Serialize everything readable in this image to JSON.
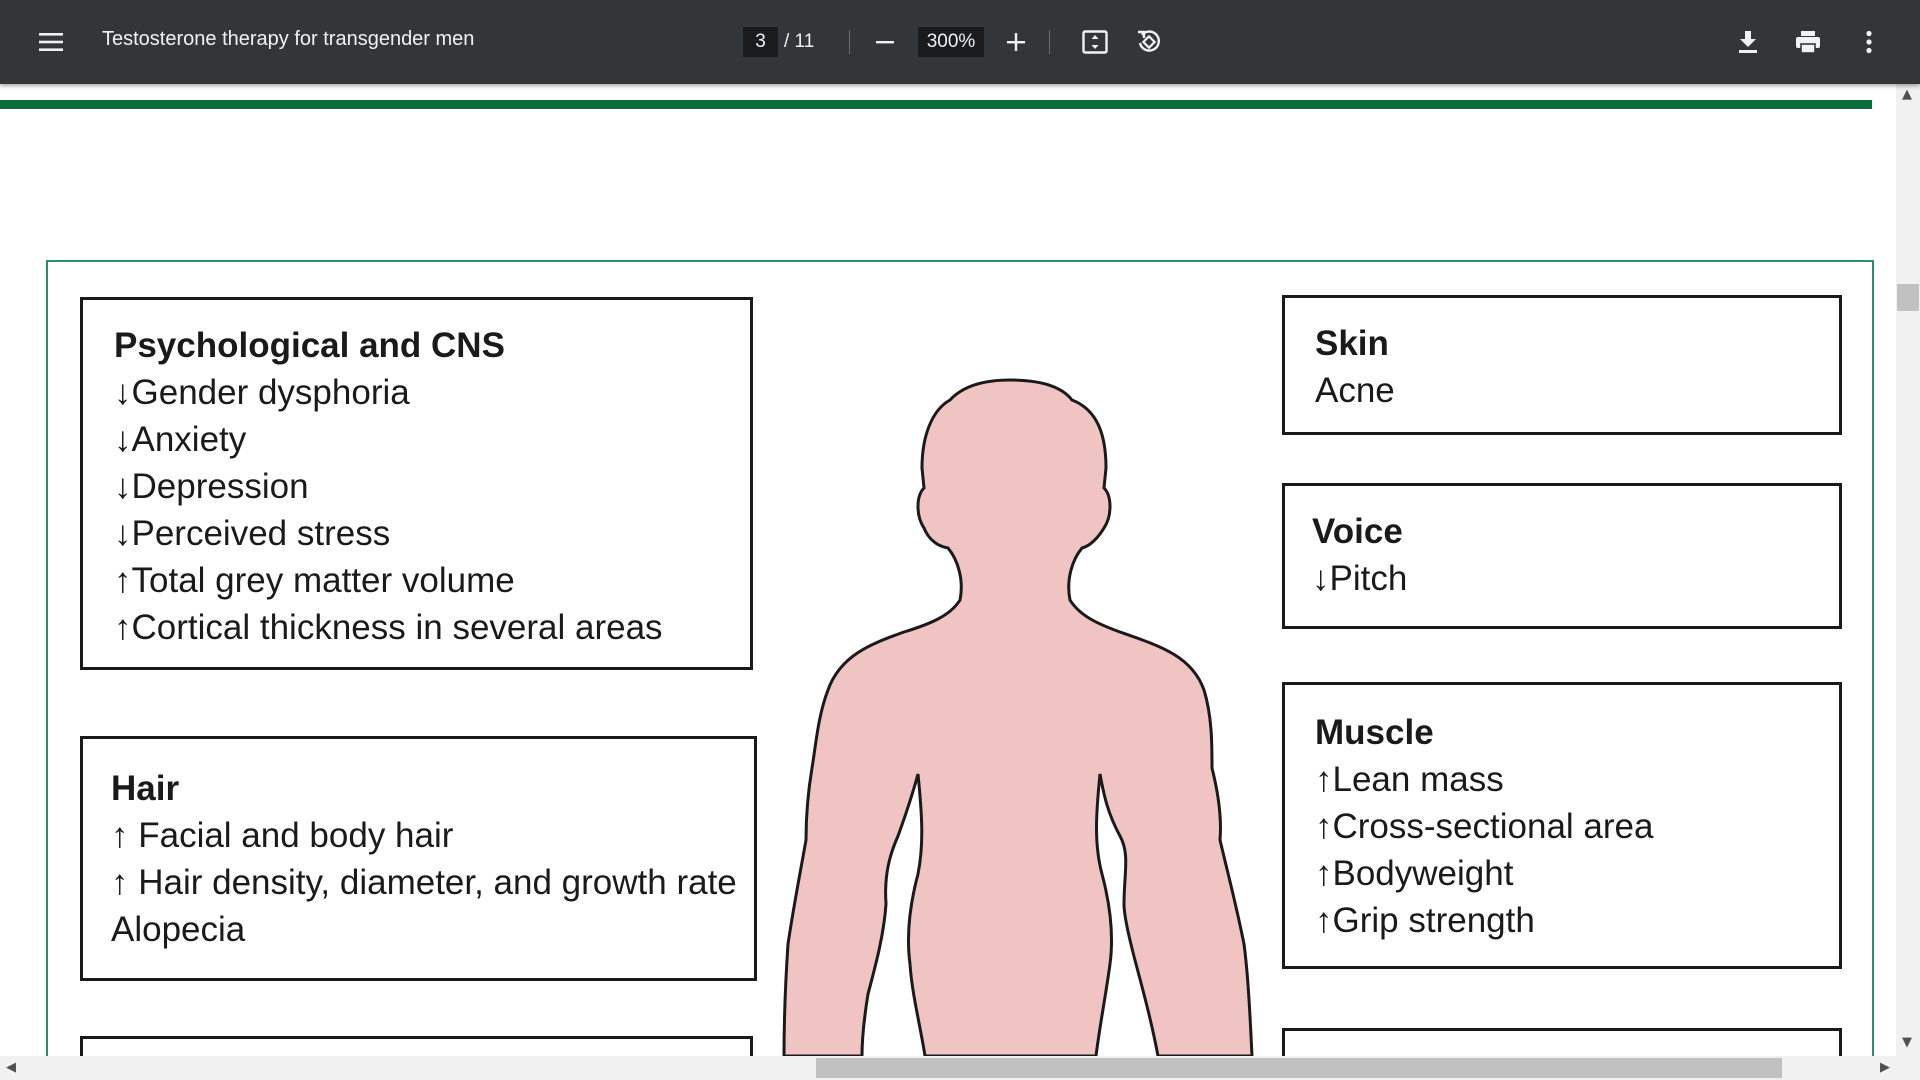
{
  "toolbar": {
    "menu_icon": "hamburger-menu-icon",
    "title": "Testosterone therapy for transgender men",
    "current_page": "3",
    "page_total": "/ 11",
    "zoom": "300%",
    "icons": [
      "minus-icon",
      "plus-icon",
      "fit-page-icon",
      "rotate-icon",
      "download-icon",
      "print-icon",
      "more-vert-icon"
    ]
  },
  "figure": {
    "psych": {
      "heading": "Psychological and CNS",
      "lines": [
        "↓Gender dysphoria",
        "↓Anxiety",
        "↓Depression",
        "↓Perceived stress",
        "↑Total grey matter volume",
        "↑Cortical thickness in several areas"
      ]
    },
    "hair": {
      "heading": "Hair",
      "lines": [
        "↑ Facial and body hair",
        "↑ Hair density, diameter, and growth rate",
        "Alopecia"
      ]
    },
    "skin": {
      "heading": "Skin",
      "lines": [
        "Acne"
      ]
    },
    "voice": {
      "heading": "Voice",
      "lines": [
        "↓Pitch"
      ]
    },
    "muscle": {
      "heading": "Muscle",
      "lines": [
        "↑Lean mass",
        "↑Cross-sectional area",
        "↑Bodyweight",
        "↑Grip strength"
      ]
    },
    "body_fill": "#f0c4c2",
    "accent_green": "#0a6e3a",
    "frame_green": "#2e8f62"
  }
}
